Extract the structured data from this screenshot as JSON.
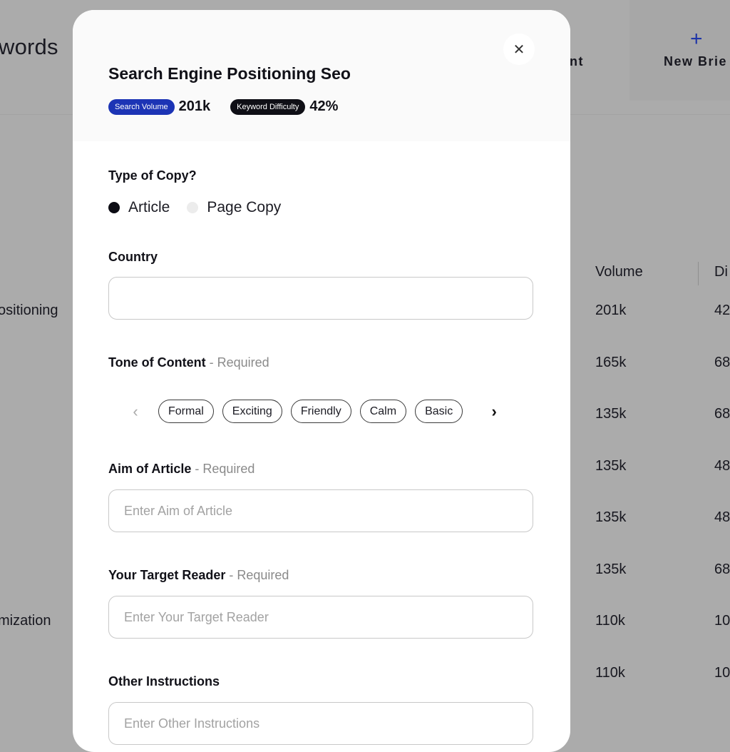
{
  "background": {
    "page_title": "words",
    "tabs": [
      {
        "label": "tent"
      }
    ],
    "new_brief": {
      "icon": "plus-icon",
      "label": "New Brie"
    },
    "table": {
      "headers": [
        "Volume",
        "Di"
      ],
      "rows": [
        {
          "keyword": "ositioning",
          "volume": "201k",
          "difficulty": "42"
        },
        {
          "keyword": "",
          "volume": "165k",
          "difficulty": "68"
        },
        {
          "keyword": "",
          "volume": "135k",
          "difficulty": "68"
        },
        {
          "keyword": "",
          "volume": "135k",
          "difficulty": "48"
        },
        {
          "keyword": "",
          "volume": "135k",
          "difficulty": "48"
        },
        {
          "keyword": "",
          "volume": "135k",
          "difficulty": "68"
        },
        {
          "keyword": "mization",
          "volume": "110k",
          "difficulty": "10"
        },
        {
          "keyword": "",
          "volume": "110k",
          "difficulty": "10"
        }
      ]
    }
  },
  "modal": {
    "title": "Search Engine Positioning Seo",
    "close_icon": "close-icon",
    "metrics": {
      "search_volume_label": "Search Volume",
      "search_volume_value": "201k",
      "keyword_difficulty_label": "Keyword Difficulty",
      "keyword_difficulty_value": "42%"
    },
    "colors": {
      "search_volume_pill": "#1c34b5",
      "difficulty_pill": "#0f0f16"
    },
    "type_of_copy": {
      "label": "Type of Copy?",
      "options": [
        {
          "label": "Article",
          "selected": true
        },
        {
          "label": "Page Copy",
          "selected": false
        }
      ]
    },
    "country": {
      "label": "Country",
      "value": "",
      "placeholder": ""
    },
    "tone": {
      "label": "Tone of Content",
      "required": " - Required",
      "options": [
        "Formal",
        "Exciting",
        "Friendly",
        "Calm",
        "Basic"
      ],
      "prev_icon": "chevron-left-icon",
      "next_icon": "chevron-right-icon"
    },
    "aim": {
      "label": "Aim of Article",
      "required": " - Required",
      "placeholder": "Enter Aim of Article",
      "value": ""
    },
    "target_reader": {
      "label": "Your Target Reader",
      "required": " - Required",
      "placeholder": "Enter Your Target Reader",
      "value": ""
    },
    "other_instructions": {
      "label": "Other Instructions",
      "placeholder": "Enter Other Instructions",
      "value": ""
    }
  }
}
